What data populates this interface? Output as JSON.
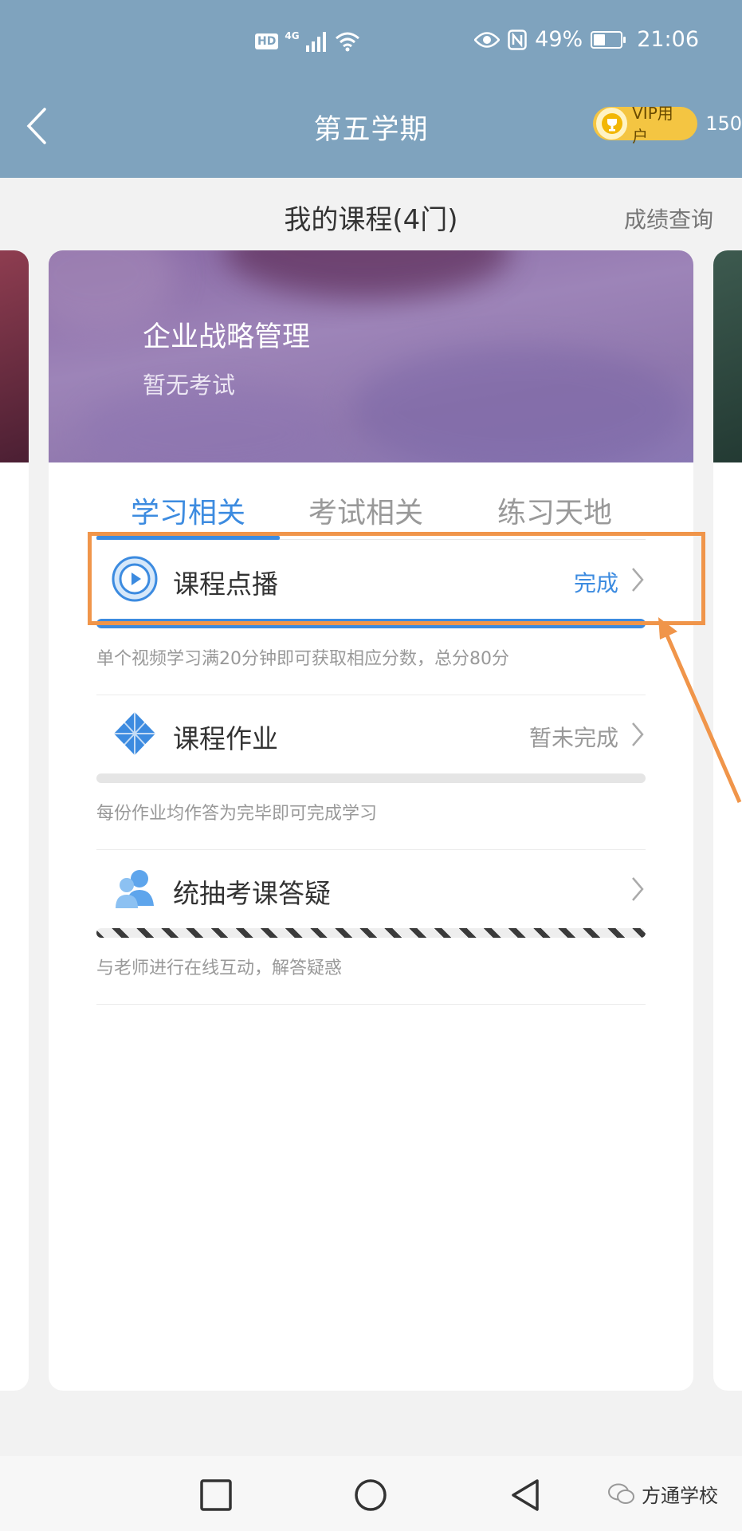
{
  "status_bar": {
    "hd": "HD",
    "network": "4G",
    "battery": "49%",
    "battery_level": 0.49,
    "time": "21:06"
  },
  "header": {
    "title": "第五学期",
    "vip_label": "VIP用户",
    "vip_count": "150"
  },
  "section": {
    "title": "我的课程(4门)",
    "grade_link": "成绩查询"
  },
  "course": {
    "name": "企业战略管理",
    "exam_status": "暂无考试"
  },
  "tabs": [
    {
      "label": "学习相关",
      "active": true
    },
    {
      "label": "考试相关",
      "active": false
    },
    {
      "label": "练习天地",
      "active": false
    }
  ],
  "items": [
    {
      "icon": "play-circle-icon",
      "title": "课程点播",
      "status": "完成",
      "progress": 1.0,
      "description": "单个视频学习满20分钟即可获取相应分数，总分80分"
    },
    {
      "icon": "diamond-icon",
      "title": "课程作业",
      "status": "暂未完成",
      "progress": 0.0,
      "description": "每份作业均作答为完毕即可完成学习"
    },
    {
      "icon": "users-icon",
      "title": "统抽考课答疑",
      "status": "",
      "progress": null,
      "description": "与老师进行在线互动，解答疑惑"
    }
  ],
  "colors": {
    "header": "#7fa3be",
    "accent": "#3c8be0",
    "annotation": "#f0954a",
    "vip": "#f4c542"
  },
  "watermark": "方通学校"
}
